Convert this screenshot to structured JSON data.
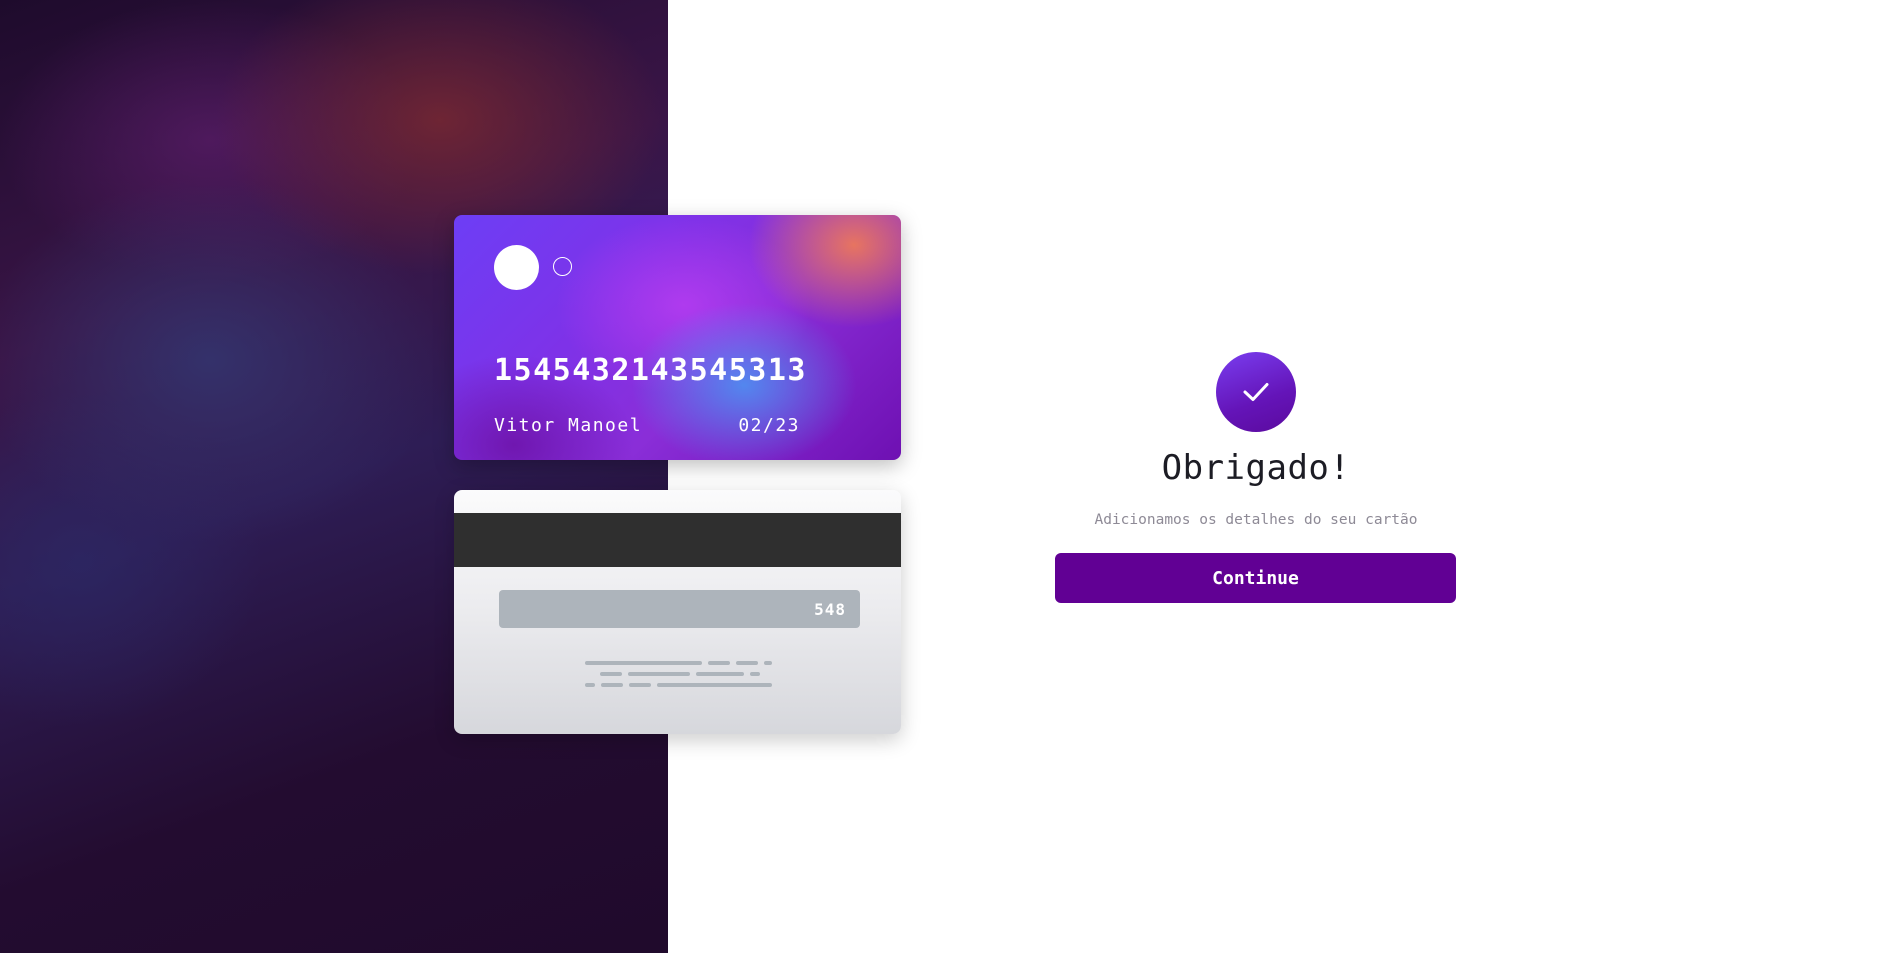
{
  "card_front": {
    "number": "1545432143545313",
    "holder_name": "Vitor Manoel",
    "expiry": "02/23"
  },
  "card_back": {
    "cvc": "548"
  },
  "success": {
    "icon": "check-icon",
    "title": "Obrigado!",
    "subtitle": "Adicionamos os detalhes do seu cartão",
    "button_label": "Continue"
  },
  "colors": {
    "accent": "#610094",
    "left_panel_bg": "#220a2e",
    "stripe": "#2f2f2f",
    "cvc_strip": "#adb4bb"
  }
}
